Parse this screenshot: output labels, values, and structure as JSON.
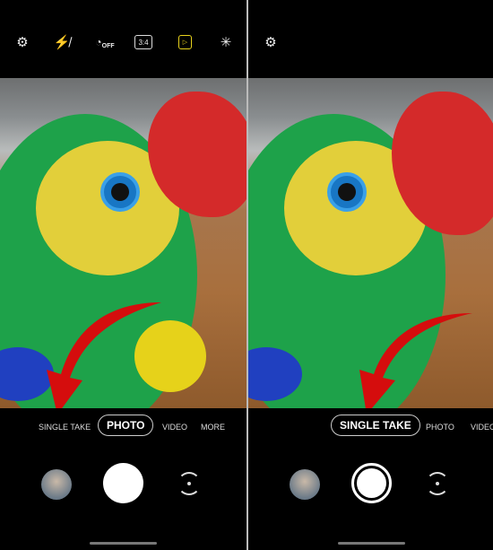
{
  "left": {
    "top_icons": [
      "settings-icon",
      "flash-off-icon",
      "timer-off-icon",
      "aspect-ratio-icon",
      "motion-photo-icon",
      "filter-effects-icon"
    ],
    "timer_label": "OFF",
    "ratio_label": "3:4",
    "modes": [
      "SINGLE TAKE",
      "PHOTO",
      "VIDEO",
      "MORE"
    ],
    "selected_mode": "PHOTO"
  },
  "right": {
    "top_icons": [
      "settings-icon"
    ],
    "modes": [
      "SINGLE TAKE",
      "PHOTO",
      "VIDEO"
    ],
    "selected_mode": "SINGLE TAKE"
  },
  "colors": {
    "accent_yellow": "#e8d21c",
    "scene_optimizer": "#1ea3e0",
    "arrow": "#d50d0d"
  }
}
